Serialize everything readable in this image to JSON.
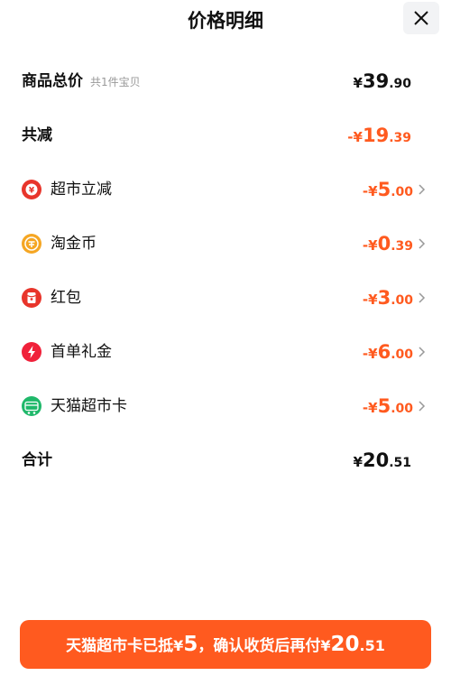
{
  "header": {
    "title": "价格明细",
    "close_icon": "close-icon"
  },
  "rows": {
    "goods_total": {
      "label": "商品总价",
      "sub": "共1件宝贝",
      "symbol": "¥",
      "int": "39",
      "dec": ".90"
    },
    "total_reduction": {
      "label": "共减",
      "symbol": "-¥",
      "int": "19",
      "dec": ".39"
    },
    "discounts": [
      {
        "label": "超市立减",
        "icon": "supermarket-discount-icon",
        "symbol": "-¥",
        "int": "5",
        "dec": ".00"
      },
      {
        "label": "淘金币",
        "icon": "taojinbi-coin-icon",
        "symbol": "-¥",
        "int": "0",
        "dec": ".39"
      },
      {
        "label": "红包",
        "icon": "red-packet-icon",
        "symbol": "-¥",
        "int": "3",
        "dec": ".00"
      },
      {
        "label": "首单礼金",
        "icon": "first-order-bonus-icon",
        "symbol": "-¥",
        "int": "6",
        "dec": ".00"
      },
      {
        "label": "天猫超市卡",
        "icon": "tmall-supermarket-card-icon",
        "symbol": "-¥",
        "int": "5",
        "dec": ".00"
      }
    ],
    "subtotal": {
      "label": "合计",
      "symbol": "¥",
      "int": "20",
      "dec": ".51"
    }
  },
  "bottom_button": {
    "prefix": "天猫超市卡已抵",
    "card_symbol": "¥",
    "card_amount": "5",
    "middle": "，确认收货后再付",
    "pay_symbol": "¥",
    "pay_int": "20",
    "pay_dec": ".51"
  },
  "colors": {
    "accent": "#ff5a1f",
    "text": "#111111",
    "muted": "#999999",
    "close_bg": "#f2f3f5"
  }
}
